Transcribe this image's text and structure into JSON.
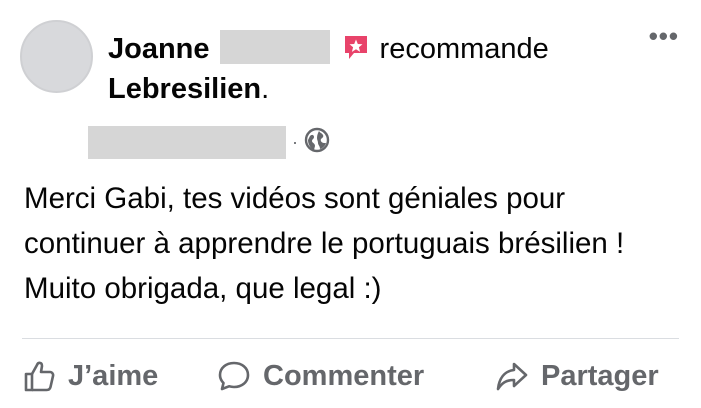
{
  "post": {
    "author_first": "Joanne",
    "verb": "recommande",
    "page_name": "Lebresilien",
    "period": ".",
    "dot": "·",
    "body": "Merci Gabi, tes vidéos sont géniales pour continuer à apprendre le portuguais brésilien ! Muito obrigada, que legal :)",
    "more": "•••"
  },
  "actions": {
    "like": "J’aime",
    "comment": "Commenter",
    "share": "Partager"
  },
  "colors": {
    "recommend_icon": "#e8436a",
    "action_gray": "#65676b",
    "text": "#050505"
  },
  "icons": [
    "recommend-star-icon",
    "globe-icon",
    "more-options-icon",
    "thumbs-up-icon",
    "comment-icon",
    "share-arrow-icon"
  ]
}
